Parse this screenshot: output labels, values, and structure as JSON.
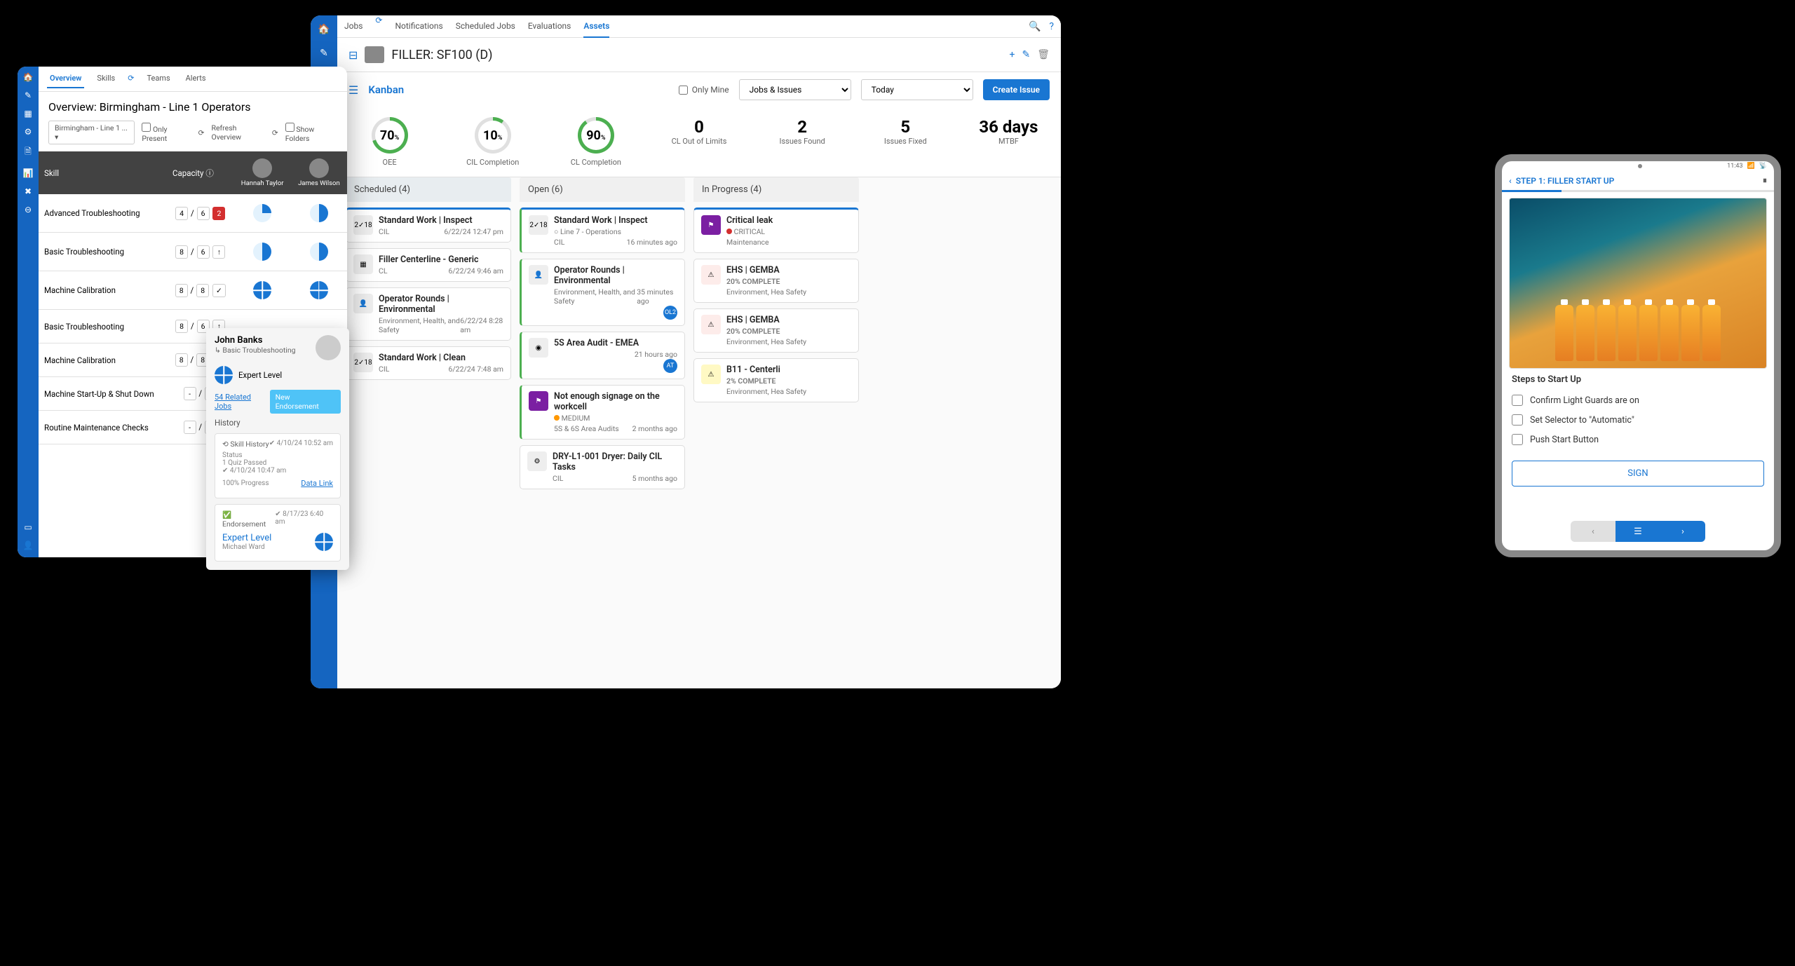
{
  "main": {
    "tabs": [
      "Jobs",
      "Notifications",
      "Scheduled Jobs",
      "Evaluations",
      "Assets"
    ],
    "activeTab": "Assets",
    "asset_title": "FILLER: SF100 (D)",
    "kanban_label": "Kanban",
    "only_mine": "Only Mine",
    "filter1": "Jobs & Issues",
    "filter2": "Today",
    "create_btn": "Create Issue",
    "metrics": [
      {
        "val": "70",
        "label": "OEE",
        "gauge": "g70"
      },
      {
        "val": "10",
        "label": "CIL Completion",
        "gauge": "g10"
      },
      {
        "val": "90",
        "label": "CL Completion",
        "gauge": "g90"
      },
      {
        "val": "0",
        "label": "CL Out of Limits"
      },
      {
        "val": "2",
        "label": "Issues Found"
      },
      {
        "val": "5",
        "label": "Issues Fixed"
      },
      {
        "val": "36 days",
        "label": "MTBF"
      }
    ],
    "columns": {
      "scheduled": {
        "title": "Scheduled (4)",
        "cards": [
          {
            "title": "Standard Work | Inspect",
            "sub": "CIL",
            "time": "6/22/24 12:47 pm"
          },
          {
            "title": "Filler Centerline - Generic",
            "sub": "CL",
            "time": "6/22/24 9:46 am"
          },
          {
            "title": "Operator Rounds | Environmental",
            "sub": "Environment, Health, and Safety",
            "time": "6/22/24 8:28 am"
          },
          {
            "title": "Standard Work | Clean",
            "sub": "CIL",
            "time": "6/22/24 7:48 am"
          }
        ]
      },
      "open": {
        "title": "Open (6)",
        "cards": [
          {
            "title": "Standard Work | Inspect",
            "sub": "CIL",
            "meta": "Line 7 - Operations",
            "time": "16 minutes ago"
          },
          {
            "title": "Operator Rounds | Environmental",
            "sub": "Environment, Health, and Safety",
            "time": "35 minutes ago",
            "av": "OL2"
          },
          {
            "title": "5S Area Audit - EMEA",
            "sub": "",
            "time": "21 hours ago",
            "av": "AT"
          },
          {
            "title": "Not enough signage on the workcell",
            "sub": "5S & 6S Area Audits",
            "sev": "MEDIUM",
            "time": "2 months ago"
          },
          {
            "title": "DRY-L1-001 Dryer: Daily CIL Tasks",
            "sub": "CIL",
            "time": "5 months ago"
          }
        ]
      },
      "progress": {
        "title": "In Progress (4)",
        "cards": [
          {
            "title": "Critical leak",
            "sub": "Maintenance",
            "sev": "CRITICAL"
          },
          {
            "title": "EHS | GEMBA",
            "pct": "20% COMPLETE",
            "sub": "Environment, Hea Safety"
          },
          {
            "title": "EHS | GEMBA",
            "pct": "20% COMPLETE",
            "sub": "Environment, Hea Safety"
          },
          {
            "title": "B11 - Centerli",
            "pct": "2% COMPLETE",
            "sub": "Environment, Hea Safety"
          }
        ]
      }
    }
  },
  "overview": {
    "tabs": [
      "Overview",
      "Skills",
      "Teams",
      "Alerts"
    ],
    "title": "Overview: Birmingham - Line 1 Operators",
    "chip": "Birmingham - Line 1 ...",
    "only_present": "Only Present",
    "refresh": "Refresh Overview",
    "show_folders": "Show Folders",
    "th_skill": "Skill",
    "th_capacity": "Capacity",
    "people": [
      "Hannah Taylor",
      "James Wilson"
    ],
    "rows": [
      {
        "name": "Advanced Troubleshooting",
        "a": "4",
        "b": "6",
        "c": "2",
        "cred": true,
        "p1": "p25",
        "p2": "p50"
      },
      {
        "name": "Basic Troubleshooting",
        "a": "8",
        "b": "6",
        "icon": "↑",
        "p1": "p50",
        "p2": "p50"
      },
      {
        "name": "Machine Calibration",
        "a": "8",
        "b": "8",
        "icon": "✓",
        "p1": "full",
        "p2": "full"
      },
      {
        "name": "Basic Troubleshooting",
        "a": "8",
        "b": "6",
        "icon": "↑"
      },
      {
        "name": "Machine Calibration",
        "a": "8",
        "b": "8",
        "icon": "✓"
      },
      {
        "name": "Machine Start-Up & Shut Down",
        "a": "-",
        "b": "-"
      },
      {
        "name": "Routine Maintenance Checks",
        "a": "-",
        "b": "-"
      }
    ]
  },
  "popover": {
    "name": "John Banks",
    "skill": "Basic Troubleshooting",
    "level": "Expert Level",
    "related": "54 Related Jobs",
    "new_end": "New Endorsement",
    "history": "History",
    "sh_title": "Skill History",
    "sh_time": "4/10/24 10:52 am",
    "sh_status": "Status",
    "sh_quiz": "1 Quiz Passed",
    "sh_ts": "4/10/24 10:47 am",
    "sh_prog": "100% Progress",
    "data_link": "Data Link",
    "end_title": "Endorsement",
    "end_time": "8/17/23 6:40 am",
    "end_level": "Expert Level",
    "end_by": "Michael Ward"
  },
  "tablet": {
    "time": "11:43",
    "step": "STEP 1:  FILLER START UP",
    "section": "Steps to Start Up",
    "checks": [
      "Confirm Light Guards are on",
      "Set Selector to \"Automatic\"",
      "Push Start Button"
    ],
    "sign": "SIGN"
  }
}
